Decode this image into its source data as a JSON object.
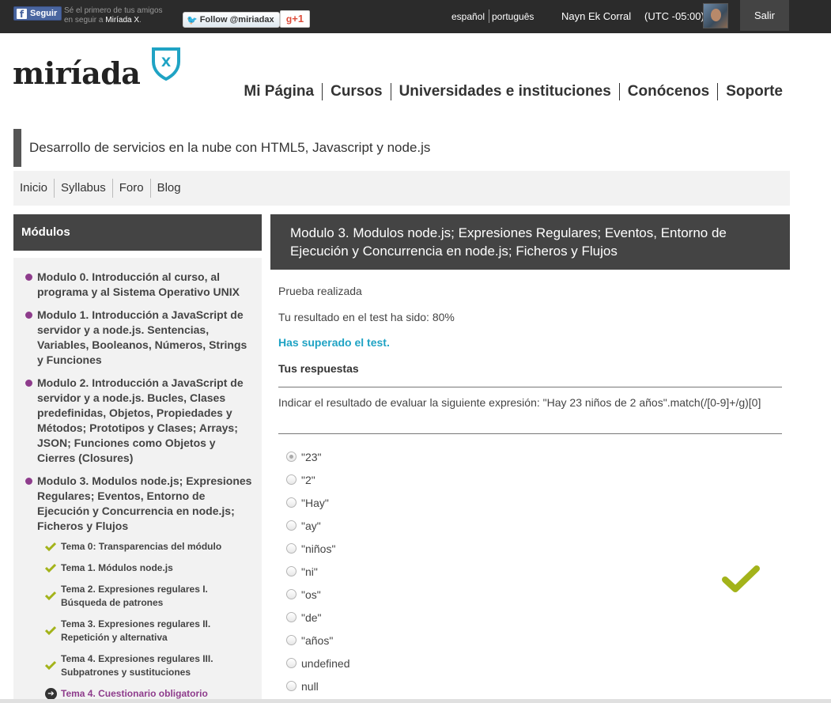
{
  "topbar": {
    "fb_follow": "Seguir",
    "fb_text_line1": "Sé el primero de tus amigos",
    "fb_text_line2_prefix": "en seguir a",
    "fb_text_line2_name": "Miríada X",
    "fb_text_line2_suffix": ".",
    "twitter_follow": "Follow @miriadax",
    "gplus": "+1",
    "lang_es": "español",
    "lang_pt": "português",
    "username": "Nayn Ek Corral",
    "timezone": "(UTC -05:00)",
    "logout": "Salir"
  },
  "logo": {
    "text": "miríada",
    "badge": "X",
    "color": "#1fa3c4"
  },
  "nav": [
    "Mi Página",
    "Cursos",
    "Universidades e instituciones",
    "Conócenos",
    "Soporte"
  ],
  "course": {
    "title": "Desarrollo de servicios en la nube con HTML5, Javascript y node.js",
    "subnav": [
      "Inicio",
      "Syllabus",
      "Foro",
      "Blog"
    ]
  },
  "sidebar": {
    "heading": "Módulos",
    "modules": [
      "Modulo 0. Introducción al curso, al programa y al Sistema Operativo UNIX",
      "Modulo 1. Introducción a JavaScript de servidor y a node.js. Sentencias, Variables, Booleanos, Números, Strings y Funciones",
      "Modulo 2. Introducción a JavaScript de servidor y a node.js. Bucles, Clases predefinidas, Objetos, Propiedades y Métodos; Prototipos y Clases; Arrays; JSON; Funciones como Objetos y Cierres (Closures)",
      "Modulo 3. Modulos node.js; Expresiones Regulares; Eventos, Entorno de Ejecución y Concurrencia en node.js; Ficheros y Flujos"
    ],
    "temas": [
      "Tema 0: Transparencias del módulo",
      "Tema 1. Módulos node.js",
      "Tema 2. Expresiones regulares I. Búsqueda de patrones",
      "Tema 3. Expresiones regulares II. Repetición y alternativa",
      "Tema 4. Expresiones regulares III. Subpatrones y sustituciones"
    ],
    "active_tema": "Tema 4. Cuestionario obligatorio",
    "accent": "#8e3c8c",
    "check_color": "#a3b31a"
  },
  "main": {
    "heading": "Modulo 3. Modulos node.js; Expresiones Regulares; Eventos, Entorno de Ejecución y Concurrencia en node.js; Ficheros y Flujos",
    "status": "Prueba realizada",
    "result": "Tu resultado en el test ha sido: 80%",
    "passed": "Has superado el test.",
    "answers_heading": "Tus respuestas",
    "question": "Indicar el resultado de evaluar la siguiente expresión: \"Hay 23 niños de 2 años\".match(/[0-9]+/g)[0]",
    "options": [
      "\"23\"",
      "\"2\"",
      "\"Hay\"",
      "\"ay\"",
      "\"niños\"",
      "\"ni\"",
      "\"os\"",
      "\"de\"",
      "\"años\"",
      "undefined",
      "null"
    ],
    "selected_option": "\"23\"",
    "correct_icon": "checkmark-icon"
  }
}
